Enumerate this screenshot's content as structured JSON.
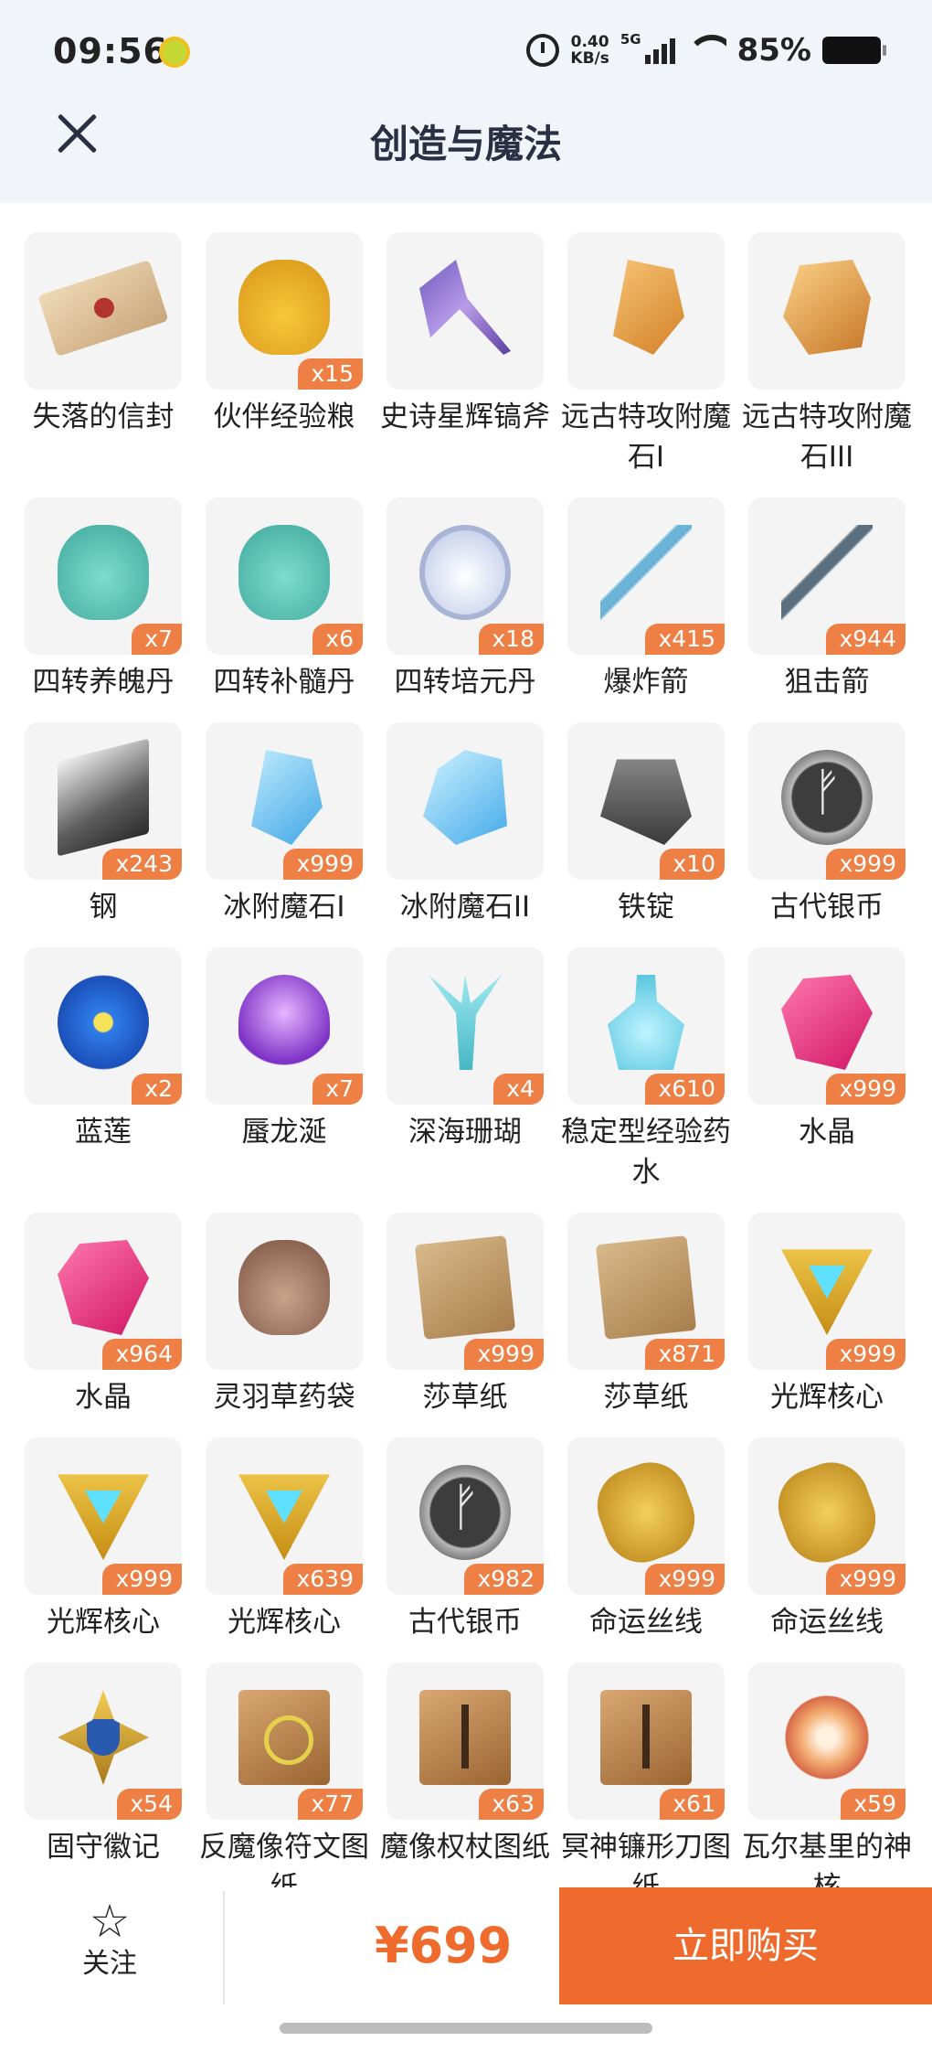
{
  "status_bar": {
    "time": "09:56",
    "net_speed_value": "0.40",
    "net_speed_unit": "KB/s",
    "signal": "5G",
    "battery": "85%"
  },
  "header": {
    "title": "创造与魔法"
  },
  "items": [
    {
      "name": "失落的信封",
      "qty": "",
      "icon": "s-envelope"
    },
    {
      "name": "伙伴经验粮",
      "qty": "x15",
      "icon": "s-bag"
    },
    {
      "name": "史诗星辉镐斧",
      "qty": "",
      "icon": "s-axe"
    },
    {
      "name": "远古特攻附魔石I",
      "qty": "",
      "icon": "s-stone-orange"
    },
    {
      "name": "远古特攻附魔石III",
      "qty": "",
      "icon": "s-stone-orange-big"
    },
    {
      "name": "四转养魄丹",
      "qty": "x7",
      "icon": "s-potion-green"
    },
    {
      "name": "四转补髓丹",
      "qty": "x6",
      "icon": "s-potion-green"
    },
    {
      "name": "四转培元丹",
      "qty": "x18",
      "icon": "s-potion-white"
    },
    {
      "name": "爆炸箭",
      "qty": "x415",
      "icon": "s-arrows"
    },
    {
      "name": "狙击箭",
      "qty": "x944",
      "icon": "s-arrows-dark"
    },
    {
      "name": "钢",
      "qty": "x243",
      "icon": "s-steel"
    },
    {
      "name": "冰附魔石I",
      "qty": "x999",
      "icon": "s-ice"
    },
    {
      "name": "冰附魔石II",
      "qty": "",
      "icon": "s-ice-big"
    },
    {
      "name": "铁锭",
      "qty": "x10",
      "icon": "s-ingot"
    },
    {
      "name": "古代银币",
      "qty": "x999",
      "icon": "s-coin"
    },
    {
      "name": "蓝莲",
      "qty": "x2",
      "icon": "s-lotus"
    },
    {
      "name": "蜃龙涎",
      "qty": "x7",
      "icon": "s-bowl"
    },
    {
      "name": "深海珊瑚",
      "qty": "x4",
      "icon": "s-coral"
    },
    {
      "name": "稳定型经验药水",
      "qty": "x610",
      "icon": "s-bottle"
    },
    {
      "name": "水晶",
      "qty": "x999",
      "icon": "s-crystal"
    },
    {
      "name": "水晶",
      "qty": "x964",
      "icon": "s-crystal"
    },
    {
      "name": "灵羽草药袋",
      "qty": "",
      "icon": "s-pouch"
    },
    {
      "name": "莎草纸",
      "qty": "x999",
      "icon": "s-scroll"
    },
    {
      "name": "莎草纸",
      "qty": "x871",
      "icon": "s-scroll"
    },
    {
      "name": "光辉核心",
      "qty": "x999",
      "icon": "s-triangle"
    },
    {
      "name": "光辉核心",
      "qty": "x999",
      "icon": "s-triangle"
    },
    {
      "name": "光辉核心",
      "qty": "x639",
      "icon": "s-triangle"
    },
    {
      "name": "古代银币",
      "qty": "x982",
      "icon": "s-coin"
    },
    {
      "name": "命运丝线",
      "qty": "x999",
      "icon": "s-thread"
    },
    {
      "name": "命运丝线",
      "qty": "x999",
      "icon": "s-thread"
    },
    {
      "name": "固守徽记",
      "qty": "x54",
      "icon": "s-badge"
    },
    {
      "name": "反魔像符文图纸",
      "qty": "x77",
      "icon": "s-blueprint"
    },
    {
      "name": "魔像权杖图纸",
      "qty": "x63",
      "icon": "s-blueprint-plain"
    },
    {
      "name": "冥神镰形刀图纸",
      "qty": "x61",
      "icon": "s-blueprint-plain"
    },
    {
      "name": "瓦尔基里的神核",
      "qty": "x59",
      "icon": "s-emblem"
    }
  ],
  "bottom_bar": {
    "follow_label": "关注",
    "price": "¥699",
    "buy_label": "立即购买"
  },
  "colors": {
    "accent": "#ee6b2d",
    "qty_badge": "#ee8046",
    "header_bg": "#f1f4f8"
  }
}
